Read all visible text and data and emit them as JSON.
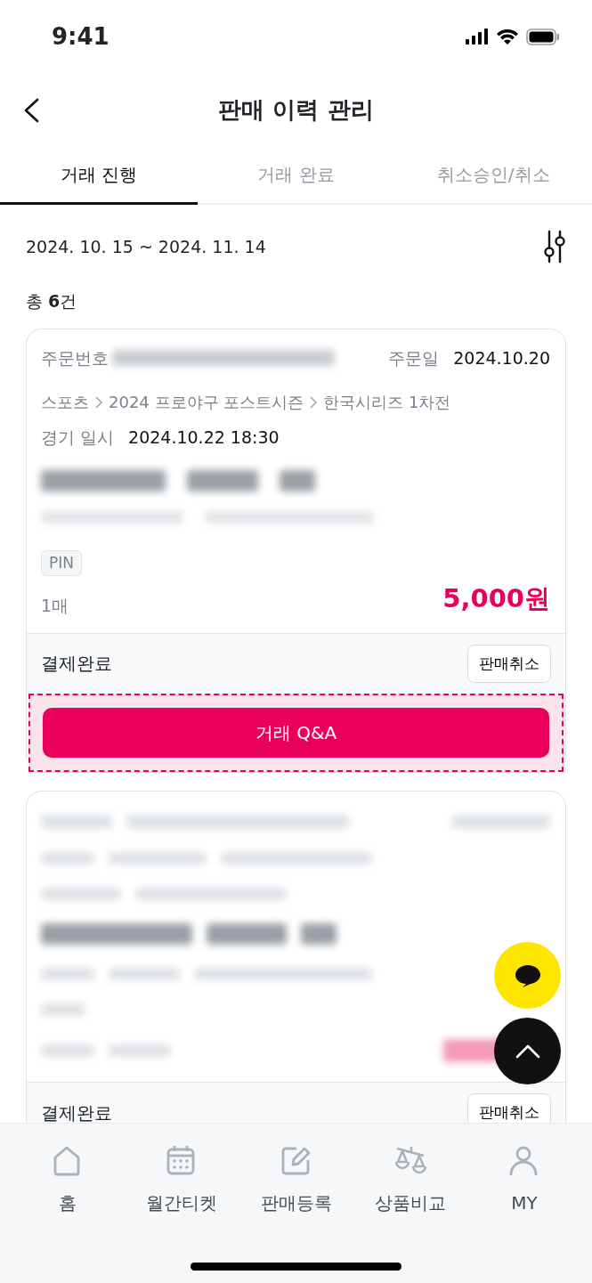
{
  "status_bar": {
    "time": "9:41"
  },
  "header": {
    "title": "판매 이력 관리"
  },
  "tabs": [
    {
      "label": "거래 진행",
      "selected": true
    },
    {
      "label": "거래 완료",
      "selected": false
    },
    {
      "label": "취소승인/취소",
      "selected": false
    }
  ],
  "date_range": "2024. 10. 15 ~ 2024. 11. 14",
  "total": "총 **6**건",
  "orders": [
    {
      "kind": "full",
      "order_no_label": "주문번호",
      "order_date_label": "주문일",
      "order_date": "2024.10.20",
      "breadcrumb": [
        "스포츠",
        "2024 프로야구 포스트시즌",
        "한국시리즈 1차전"
      ],
      "event_label": "경기 일시",
      "event_datetime": "2024.10.22 18:30",
      "tag": "PIN",
      "quantity": "1매",
      "price": "5,000원",
      "status": "결제완료",
      "cancel_button": "판매취소",
      "qa_button": "거래 Q&A",
      "highlighted": true
    },
    {
      "kind": "blurred",
      "status": "결제완료",
      "cancel_button": "판매취소"
    }
  ],
  "bottom_nav": [
    {
      "label": "홈",
      "selected": false
    },
    {
      "label": "월간티켓",
      "selected": false
    },
    {
      "label": "판매등록",
      "selected": false
    },
    {
      "label": "상품비교",
      "selected": false
    },
    {
      "label": "MY",
      "selected": false
    }
  ]
}
